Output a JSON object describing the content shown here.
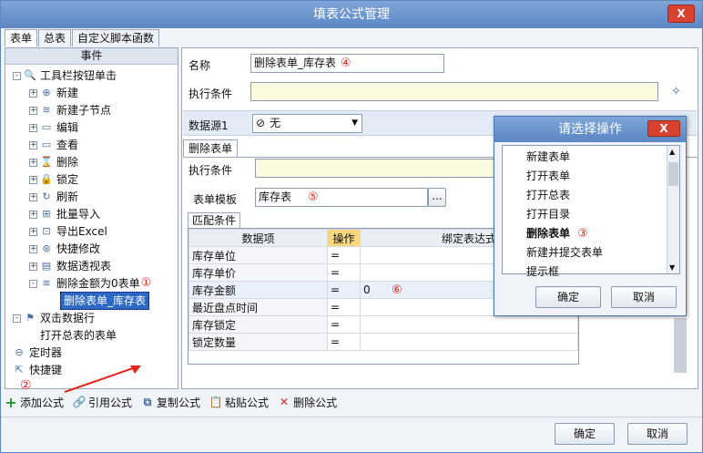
{
  "window": {
    "title": "填表公式管理",
    "close": "X"
  },
  "tabs": [
    "表单",
    "总表",
    "自定义脚本函数"
  ],
  "left": {
    "header": "事件",
    "tree": [
      {
        "label": "工具栏按钮单击",
        "level": 0,
        "exp": "-",
        "icon": "🔍"
      },
      {
        "label": "新建",
        "level": 1,
        "exp": "+",
        "icon": "⊕"
      },
      {
        "label": "新建子节点",
        "level": 1,
        "exp": "+",
        "icon": "≋"
      },
      {
        "label": "编辑",
        "level": 1,
        "exp": "+",
        "icon": "▭"
      },
      {
        "label": "查看",
        "level": 1,
        "exp": "+",
        "icon": "▭"
      },
      {
        "label": "删除",
        "level": 1,
        "exp": "+",
        "icon": "⌛"
      },
      {
        "label": "锁定",
        "level": 1,
        "exp": "+",
        "icon": "🔒"
      },
      {
        "label": "刷新",
        "level": 1,
        "exp": "+",
        "icon": "↻"
      },
      {
        "label": "批量导入",
        "level": 1,
        "exp": "+",
        "icon": "⊞"
      },
      {
        "label": "导出Excel",
        "level": 1,
        "exp": "+",
        "icon": "⊡"
      },
      {
        "label": "快捷修改",
        "level": 1,
        "exp": "+",
        "icon": "⊛"
      },
      {
        "label": "数据透视表",
        "level": 1,
        "exp": "+",
        "icon": "▤"
      },
      {
        "label": "删除金额为0表单",
        "level": 1,
        "exp": "-",
        "icon": "≋",
        "badge": "①"
      },
      {
        "label": "删除表单_库存表",
        "level": 2,
        "exp": "",
        "icon": "",
        "selected": true
      },
      {
        "label": "双击数据行",
        "level": 0,
        "exp": "-",
        "icon": "⚑"
      },
      {
        "label": "打开总表的表单",
        "level": 1,
        "exp": "",
        "icon": ""
      },
      {
        "label": "定时器",
        "level": 0,
        "exp": "",
        "icon": "⊖"
      },
      {
        "label": "快捷键",
        "level": 0,
        "exp": "",
        "icon": "⇱"
      }
    ],
    "badge2": "②"
  },
  "toolbar": [
    {
      "label": "添加公式",
      "icon": "+"
    },
    {
      "label": "引用公式",
      "icon": "🔗"
    },
    {
      "label": "复制公式",
      "icon": "⧉"
    },
    {
      "label": "粘贴公式",
      "icon": "📋"
    },
    {
      "label": "删除公式",
      "icon": "✕"
    }
  ],
  "footer": {
    "ok": "确定",
    "cancel": "取消"
  },
  "form": {
    "name_label": "名称",
    "name_value": "删除表单_库存表",
    "badge4": "④",
    "cond_label": "执行条件",
    "ds_label": "数据源1",
    "ds_value": "无",
    "subtab": "删除表单",
    "sub_cond_label": "执行条件",
    "template_label": "表单模板",
    "template_value": "库存表",
    "badge5": "⑤",
    "browse": "...",
    "match_tab": "匹配条件",
    "grid_headers": [
      "数据项",
      "操作",
      "绑定表达式"
    ],
    "grid_rows": [
      [
        "库存单位",
        "=",
        ""
      ],
      [
        "库存单价",
        "=",
        ""
      ],
      [
        "库存金额",
        "=",
        "0"
      ],
      [
        "最近盘点时间",
        "=",
        ""
      ],
      [
        "库存锁定",
        "=",
        ""
      ],
      [
        "锁定数量",
        "=",
        ""
      ]
    ],
    "badge6": "⑥"
  },
  "dialog": {
    "title": "请选择操作",
    "close": "X",
    "items": [
      "新建表单",
      "打开表单",
      "打开总表",
      "打开目录",
      "删除表单",
      "新建并提交表单",
      "提示框"
    ],
    "selected_index": 4,
    "badge3": "③",
    "ok": "确定",
    "cancel": "取消"
  }
}
